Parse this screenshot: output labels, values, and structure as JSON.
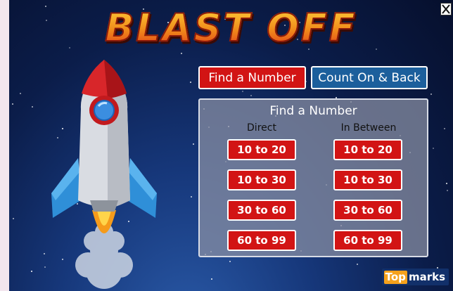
{
  "game": {
    "title": "BLAST OFF"
  },
  "toolbar": {
    "close_icon": "close-x-icon"
  },
  "modes": {
    "find_label": "Find a Number",
    "count_label": "Count On & Back",
    "selected": "Find a Number"
  },
  "panel": {
    "title": "Find a Number",
    "columns": {
      "direct": "Direct",
      "between": "In Between"
    },
    "direct_ranges": [
      "10 to 20",
      "10 to 30",
      "30 to 60",
      "60 to 99"
    ],
    "between_ranges": [
      "10 to 20",
      "10 to 30",
      "30 to 60",
      "60 to 99"
    ]
  },
  "logo": {
    "top": "Top",
    "marks": "marks"
  },
  "colors": {
    "red_button": "#d21414",
    "blue_button": "#1c5f9c",
    "sky_dark": "#060f2c",
    "logo_orange": "#f5a11c"
  }
}
